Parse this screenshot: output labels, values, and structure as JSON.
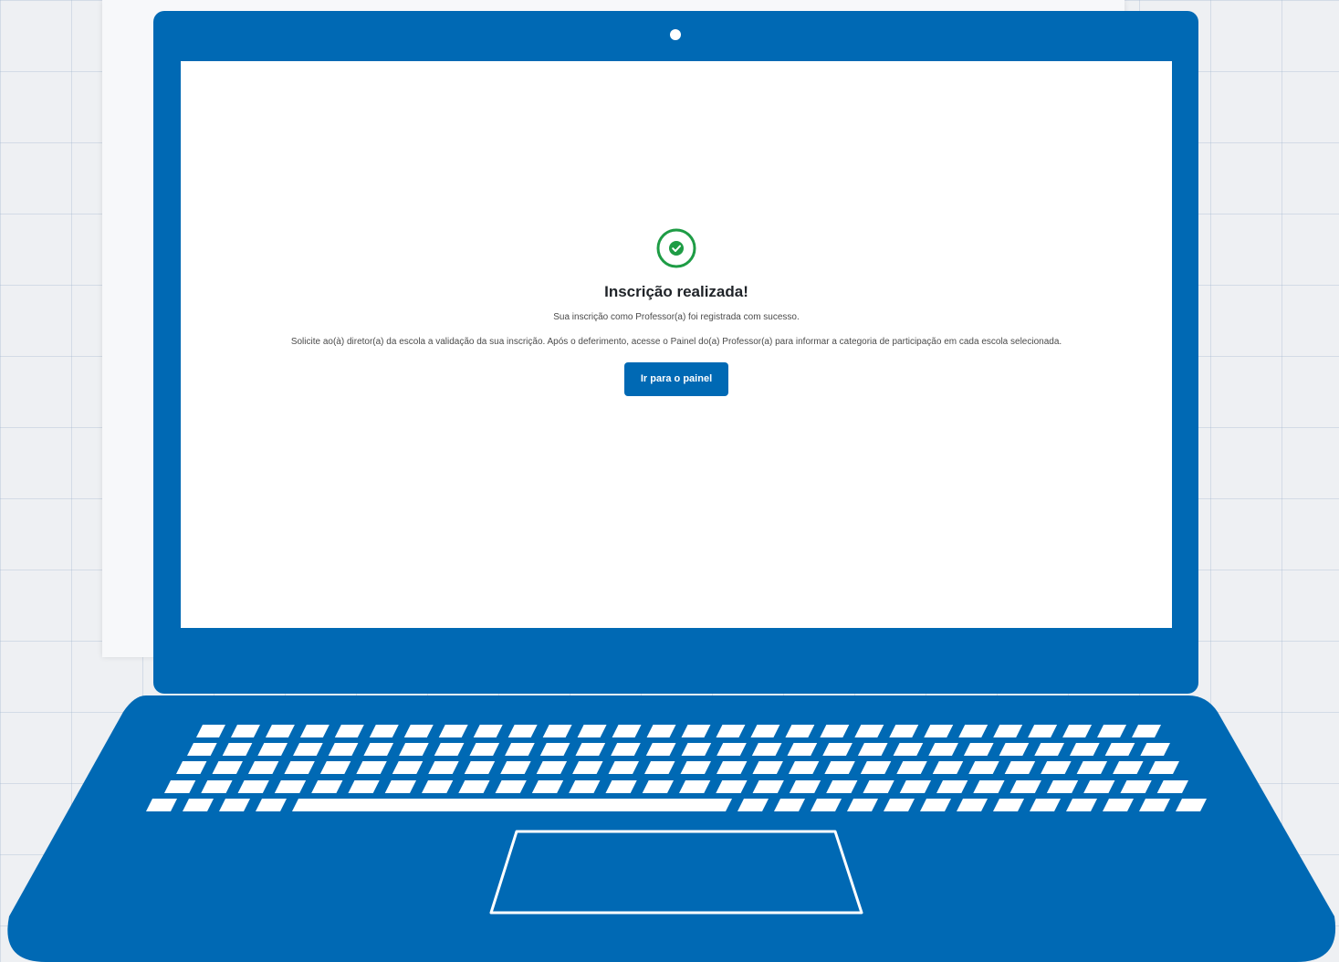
{
  "colors": {
    "laptop_blue": "#0069b4",
    "success_green": "#1e9c45",
    "button_blue": "#0069b4"
  },
  "icons": {
    "success": "check-circle-icon",
    "camera": "webcam-icon"
  },
  "success": {
    "title": "Inscrição realizada!",
    "subtitle": "Sua inscrição como Professor(a) foi registrada com sucesso.",
    "instructions": "Solicite ao(à) diretor(a) da escola a validação da sua inscrição. Após o deferimento, acesse o Painel do(a) Professor(a) para informar a categoria de participação em cada escola selecionada.",
    "button_label": "Ir para o painel"
  }
}
